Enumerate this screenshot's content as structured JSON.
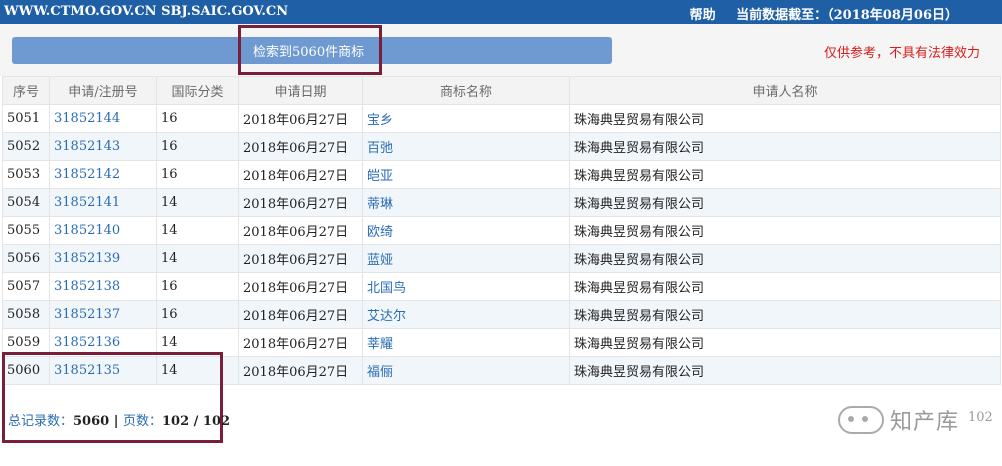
{
  "header": {
    "site": "WWW.CTMO.GOV.CN SBJ.SAIC.GOV.CN",
    "help": "帮助",
    "data_as_of": "当前数据截至：（2018年08月06日）"
  },
  "search": {
    "result_text": "检索到5060件商标",
    "disclaimer": "仅供参考，不具有法律效力"
  },
  "table": {
    "columns": [
      "序号",
      "申请/注册号",
      "国际分类",
      "申请日期",
      "商标名称",
      "申请人名称"
    ],
    "rows": [
      {
        "seq": "5051",
        "reg": "31852144",
        "cls": "16",
        "date": "2018年06月27日",
        "name": "宝乡",
        "applicant": "珠海典昱贸易有限公司"
      },
      {
        "seq": "5052",
        "reg": "31852143",
        "cls": "16",
        "date": "2018年06月27日",
        "name": "百弛",
        "applicant": "珠海典昱贸易有限公司"
      },
      {
        "seq": "5053",
        "reg": "31852142",
        "cls": "16",
        "date": "2018年06月27日",
        "name": "皑亚",
        "applicant": "珠海典昱贸易有限公司"
      },
      {
        "seq": "5054",
        "reg": "31852141",
        "cls": "14",
        "date": "2018年06月27日",
        "name": "蒂琳",
        "applicant": "珠海典昱贸易有限公司"
      },
      {
        "seq": "5055",
        "reg": "31852140",
        "cls": "14",
        "date": "2018年06月27日",
        "name": "欧绮",
        "applicant": "珠海典昱贸易有限公司"
      },
      {
        "seq": "5056",
        "reg": "31852139",
        "cls": "14",
        "date": "2018年06月27日",
        "name": "蓝娅",
        "applicant": "珠海典昱贸易有限公司"
      },
      {
        "seq": "5057",
        "reg": "31852138",
        "cls": "16",
        "date": "2018年06月27日",
        "name": "北国鸟",
        "applicant": "珠海典昱贸易有限公司"
      },
      {
        "seq": "5058",
        "reg": "31852137",
        "cls": "16",
        "date": "2018年06月27日",
        "name": "艾达尔",
        "applicant": "珠海典昱贸易有限公司"
      },
      {
        "seq": "5059",
        "reg": "31852136",
        "cls": "14",
        "date": "2018年06月27日",
        "name": "莘耀",
        "applicant": "珠海典昱贸易有限公司"
      },
      {
        "seq": "5060",
        "reg": "31852135",
        "cls": "14",
        "date": "2018年06月27日",
        "name": "福俪",
        "applicant": "珠海典昱贸易有限公司"
      }
    ]
  },
  "footer": {
    "total_label": "总记录数：",
    "total_value": "5060",
    "sep": " | ",
    "pages_label": "页数：",
    "pages_value": "102 / 102"
  },
  "watermark": {
    "text": "知产库",
    "page_hint": "102"
  },
  "colors": {
    "topbar": "#1f5fa6",
    "result_bar": "#6f9ad1",
    "link": "#2a6cb3",
    "disclaimer": "#d91a1a",
    "highlight_box": "#7a1f3a"
  }
}
